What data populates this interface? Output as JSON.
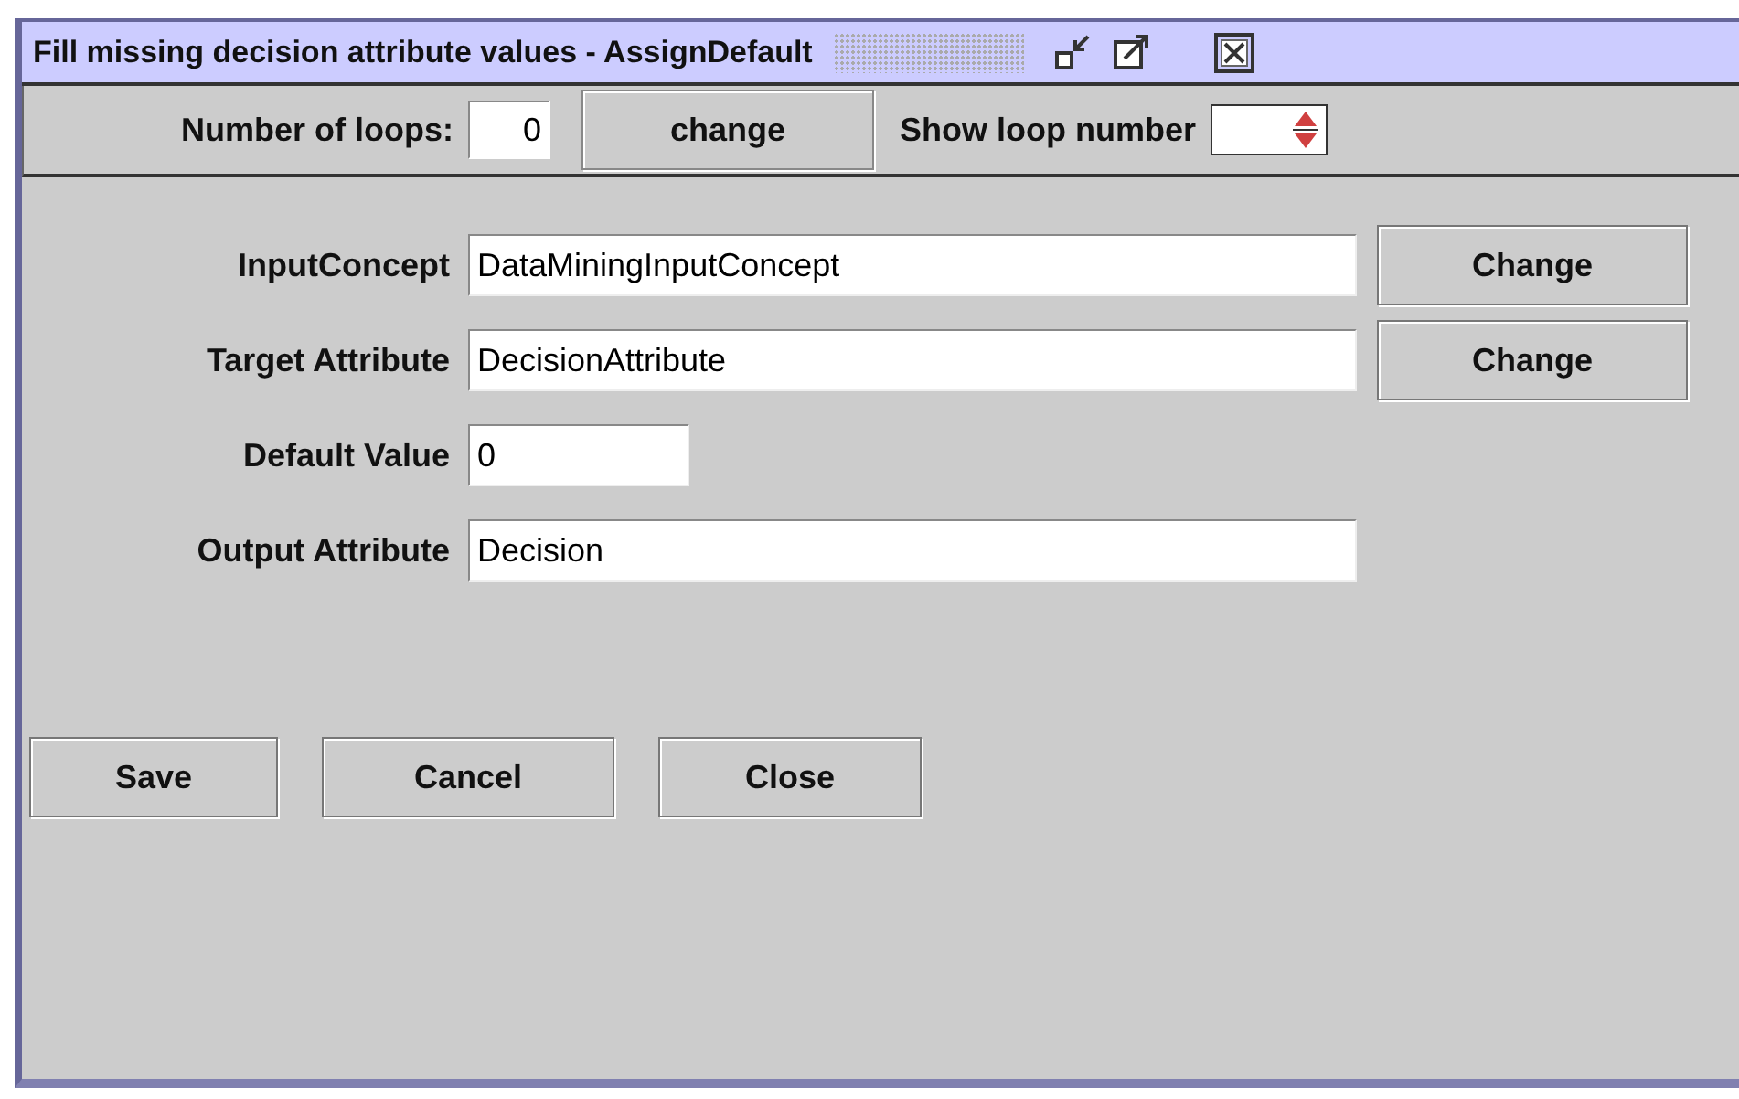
{
  "window": {
    "title": "Fill missing decision attribute values - AssignDefault"
  },
  "toolbar": {
    "loops_label": "Number of loops:",
    "loops_value": "0",
    "change_button": "change",
    "show_label": "Show loop number"
  },
  "fields": [
    {
      "label": "InputConcept",
      "value": "DataMiningInputConcept",
      "kind": "wide",
      "button": "Change"
    },
    {
      "label": "Target Attribute",
      "value": "DecisionAttribute",
      "kind": "wide",
      "button": "Change"
    },
    {
      "label": "Default Value",
      "value": "0",
      "kind": "short"
    },
    {
      "label": "Output Attribute",
      "value": "Decision",
      "kind": "wide"
    }
  ],
  "buttons": [
    "Save",
    "Cancel",
    "Close"
  ]
}
